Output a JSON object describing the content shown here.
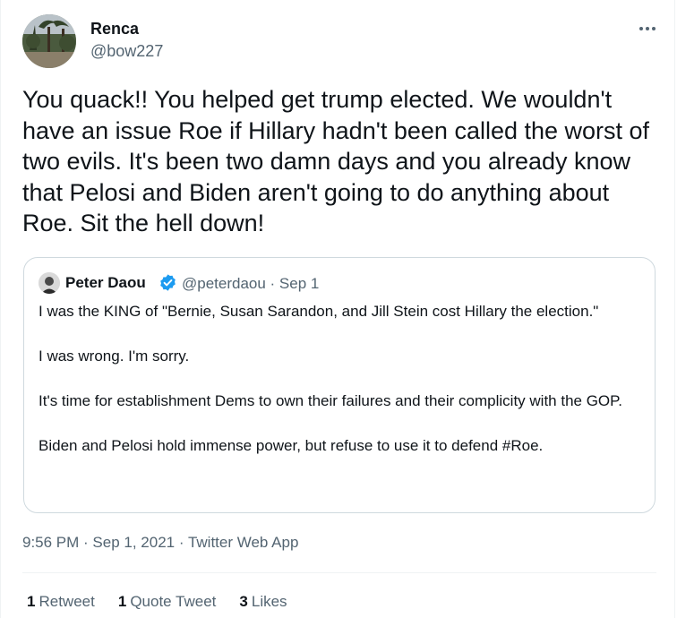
{
  "author": {
    "name": "Renca",
    "handle": "@bow227"
  },
  "tweet": {
    "text": "You quack!! You helped get trump elected. We wouldn't have an issue Roe if Hillary hadn't been called the worst of two evils. It's been two damn days and you already know that Pelosi and Biden aren't going to do anything about Roe. Sit the hell down!"
  },
  "quoted": {
    "name": "Peter Daou",
    "handle_date": "@peterdaou · Sep 1",
    "paragraphs": [
      "I was the KING of \"Bernie, Susan Sarandon, and Jill Stein cost Hillary the election.\"",
      "I was wrong. I'm sorry.",
      "It's time for establishment Dems to own their failures and their complicity with the GOP.",
      "Biden and Pelosi hold immense power, but refuse to use it to defend #Roe."
    ]
  },
  "meta": {
    "time": "9:56 PM",
    "sep1": " · ",
    "date": "Sep 1, 2021",
    "sep2": " · ",
    "source": "Twitter Web App"
  },
  "stats": {
    "retweets_count": "1",
    "retweets_label": "Retweet",
    "quotes_count": "1",
    "quotes_label": "Quote Tweet",
    "likes_count": "3",
    "likes_label": "Likes"
  },
  "colors": {
    "text": "#0f1419",
    "secondary": "#536471",
    "border": "#cfd9de",
    "verified": "#1d9bf0"
  },
  "icons": {
    "more": "more-horizontal-icon",
    "verified": "verified-badge-icon"
  }
}
